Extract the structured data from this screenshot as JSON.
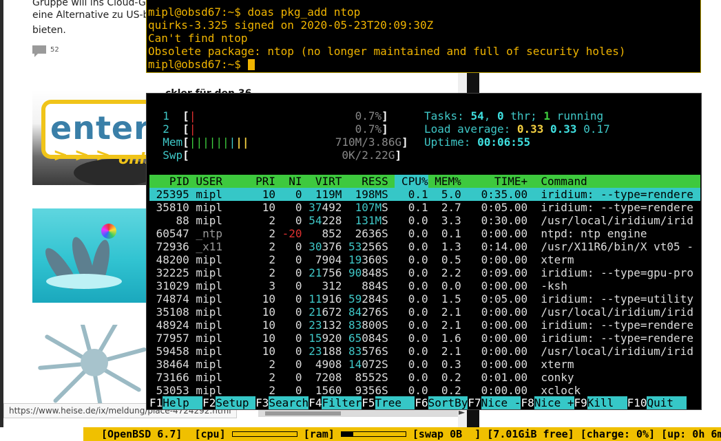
{
  "browser": {
    "text_line1": "Gruppe will ins Cloud-G",
    "text_line2": "eine Alternative zu US-b",
    "text_line3": "bieten.",
    "comment_count": "52",
    "hidden_heading": "ckler für den 36",
    "status_url": "https://www.heise.de/ix/meldung/place-4724292.html"
  },
  "xterm": {
    "lines": [
      "mipl@obsd67:~$ doas pkg_add ntop",
      "quirks-3.325 signed on 2020-05-23T20:09:30Z",
      "Can't find ntop",
      "Obsolete package: ntop (no longer maintained and full of security holes)"
    ],
    "prompt": "mipl@obsd67:~$ "
  },
  "htop": {
    "meters": {
      "cpu1_label": "1",
      "cpu1_value": "0.7%",
      "cpu2_label": "2",
      "cpu2_value": "0.7%",
      "mem_label": "Mem",
      "mem_value": "710M/3.86G",
      "swp_label": "Swp",
      "swp_value": "0K/2.22G"
    },
    "summary": {
      "tasks_label": "Tasks: ",
      "tasks": "54",
      "thr": "0",
      "thr_label": " thr; ",
      "running": "1",
      "running_label": " running",
      "load_label": "Load average: ",
      "load1": "0.33",
      "load5": "0.33",
      "load15": "0.17",
      "uptime_label": "Uptime: ",
      "uptime": "00:06:55"
    },
    "columns": [
      "PID",
      "USER",
      "PRI",
      "NI",
      "VIRT",
      "RES",
      "S",
      "CPU%",
      "MEM%",
      "TIME+",
      "Command"
    ],
    "processes": [
      {
        "pid": "25395",
        "user": "mipl",
        "pri": "10",
        "ni": "0",
        "virt": "119M",
        "res": "198M",
        "s": "S",
        "cpu": "0.1",
        "mem": "5.0",
        "time": "0:35.00",
        "cmd": "iridium: --type=rendere"
      },
      {
        "pid": "35810",
        "user": "mipl",
        "pri": "10",
        "ni": "0",
        "virt": "37492",
        "res": "107M",
        "s": "S",
        "cpu": "0.1",
        "mem": "2.7",
        "time": "0:05.00",
        "cmd": "iridium: --type=rendere"
      },
      {
        "pid": "88",
        "user": "mipl",
        "pri": "2",
        "ni": "0",
        "virt": "54228",
        "res": "131M",
        "s": "S",
        "cpu": "0.0",
        "mem": "3.3",
        "time": "0:30.00",
        "cmd": "/usr/local/iridium/irid"
      },
      {
        "pid": "60547",
        "user": "_ntp",
        "pri": "2",
        "ni": "-20",
        "virt": "852",
        "res": "2636",
        "s": "S",
        "cpu": "0.0",
        "mem": "0.1",
        "time": "0:00.00",
        "cmd": "ntpd: ntp engine"
      },
      {
        "pid": "72936",
        "user": "_x11",
        "pri": "2",
        "ni": "0",
        "virt": "30376",
        "res": "53256",
        "s": "S",
        "cpu": "0.0",
        "mem": "1.3",
        "time": "0:14.00",
        "cmd": "/usr/X11R6/bin/X vt05 -"
      },
      {
        "pid": "48200",
        "user": "mipl",
        "pri": "2",
        "ni": "0",
        "virt": "7904",
        "res": "19360",
        "s": "S",
        "cpu": "0.0",
        "mem": "0.5",
        "time": "0:00.00",
        "cmd": "xterm"
      },
      {
        "pid": "32225",
        "user": "mipl",
        "pri": "2",
        "ni": "0",
        "virt": "21756",
        "res": "90848",
        "s": "S",
        "cpu": "0.0",
        "mem": "2.2",
        "time": "0:09.00",
        "cmd": "iridium: --type=gpu-pro"
      },
      {
        "pid": "31029",
        "user": "mipl",
        "pri": "3",
        "ni": "0",
        "virt": "312",
        "res": "884",
        "s": "S",
        "cpu": "0.0",
        "mem": "0.0",
        "time": "0:00.00",
        "cmd": "-ksh"
      },
      {
        "pid": "74874",
        "user": "mipl",
        "pri": "10",
        "ni": "0",
        "virt": "11916",
        "res": "59284",
        "s": "S",
        "cpu": "0.0",
        "mem": "1.5",
        "time": "0:05.00",
        "cmd": "iridium: --type=utility"
      },
      {
        "pid": "35108",
        "user": "mipl",
        "pri": "10",
        "ni": "0",
        "virt": "21672",
        "res": "84276",
        "s": "S",
        "cpu": "0.0",
        "mem": "2.1",
        "time": "0:00.00",
        "cmd": "/usr/local/iridium/irid"
      },
      {
        "pid": "48924",
        "user": "mipl",
        "pri": "10",
        "ni": "0",
        "virt": "23132",
        "res": "83800",
        "s": "S",
        "cpu": "0.0",
        "mem": "2.1",
        "time": "0:00.00",
        "cmd": "iridium: --type=rendere"
      },
      {
        "pid": "77957",
        "user": "mipl",
        "pri": "10",
        "ni": "0",
        "virt": "15920",
        "res": "65084",
        "s": "S",
        "cpu": "0.0",
        "mem": "1.6",
        "time": "0:00.00",
        "cmd": "iridium: --type=rendere"
      },
      {
        "pid": "59458",
        "user": "mipl",
        "pri": "10",
        "ni": "0",
        "virt": "23188",
        "res": "83576",
        "s": "S",
        "cpu": "0.0",
        "mem": "2.1",
        "time": "0:00.00",
        "cmd": "/usr/local/iridium/irid"
      },
      {
        "pid": "38464",
        "user": "mipl",
        "pri": "2",
        "ni": "0",
        "virt": "4908",
        "res": "14072",
        "s": "S",
        "cpu": "0.0",
        "mem": "0.3",
        "time": "0:00.00",
        "cmd": "xterm"
      },
      {
        "pid": "73166",
        "user": "mipl",
        "pri": "2",
        "ni": "0",
        "virt": "7208",
        "res": "8552",
        "s": "S",
        "cpu": "0.0",
        "mem": "0.2",
        "time": "0:01.00",
        "cmd": "conky"
      },
      {
        "pid": "53053",
        "user": "mipl",
        "pri": "2",
        "ni": "0",
        "virt": "1560",
        "res": "9356",
        "s": "S",
        "cpu": "0.0",
        "mem": "0.2",
        "time": "0:00.00",
        "cmd": "xclock"
      }
    ],
    "fkeys": [
      {
        "key": "F1",
        "label": "Help  "
      },
      {
        "key": "F2",
        "label": "Setup "
      },
      {
        "key": "F3",
        "label": "Search"
      },
      {
        "key": "F4",
        "label": "Filter"
      },
      {
        "key": "F5",
        "label": "Tree  "
      },
      {
        "key": "F6",
        "label": "SortBy"
      },
      {
        "key": "F7",
        "label": "Nice -"
      },
      {
        "key": "F8",
        "label": "Nice +"
      },
      {
        "key": "F9",
        "label": "Kill  "
      },
      {
        "key": "F10",
        "label": "Quit  "
      }
    ]
  },
  "statusbar": {
    "os": "[OpenBSD 6.7]",
    "cpu_label": "[cpu]",
    "cpu_level": 0.0,
    "ram_label": "[ram]",
    "ram_level": 0.18,
    "swap": "[swap 0B  ]",
    "free": "[7.01GiB free]",
    "charge": "[charge: 0%]",
    "uptime": "[up: 0h 6m"
  },
  "colors": {
    "terminal_amber": "#f0b400",
    "htop_cyan": "#36c7c7",
    "htop_green": "#3ec93e",
    "statusbar_yellow": "#f0c000"
  }
}
